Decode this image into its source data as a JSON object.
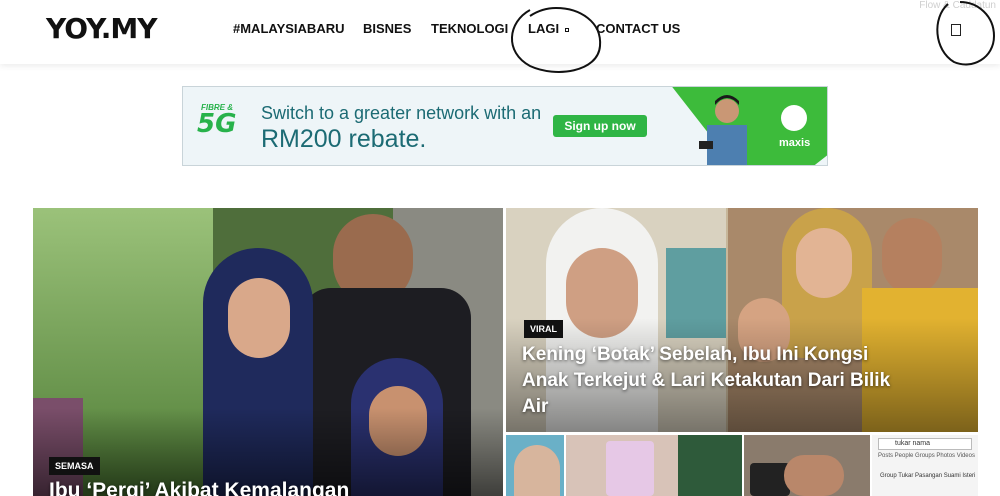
{
  "header": {
    "logo": "YOY.MY",
    "nav": [
      "#MALAYSIABARU",
      "BISNES",
      "TEKNOLOGI",
      "LAGI",
      "CONTACT US"
    ],
    "corner_text": "Flow & Caddatun"
  },
  "ad": {
    "badge_small": "FIBRE &",
    "badge_big": "5G",
    "line1": "Switch to a greater network with an",
    "line2": "RM200 rebate.",
    "cta": "Sign up now",
    "brand": "maxis"
  },
  "tiles": {
    "big": {
      "category": "SEMASA",
      "title": "Ibu ‘Pergi’ Akibat Kemalangan"
    },
    "right": {
      "category": "VIRAL",
      "title": "Kening ‘Botak’ Sebelah, Ibu Ini Kongsi Anak Terkejut & Lari Ketakutan Dari Bilik Air"
    },
    "small4": {
      "search": "tukar nama",
      "filters": "Posts  People  Groups  Photos  Videos",
      "group": "Group Tukar Pasangan Suami Isteri"
    }
  },
  "colors": {
    "accent_green": "#2fb545",
    "teal_text": "#1c6b74",
    "badge_bg": "#111111"
  }
}
